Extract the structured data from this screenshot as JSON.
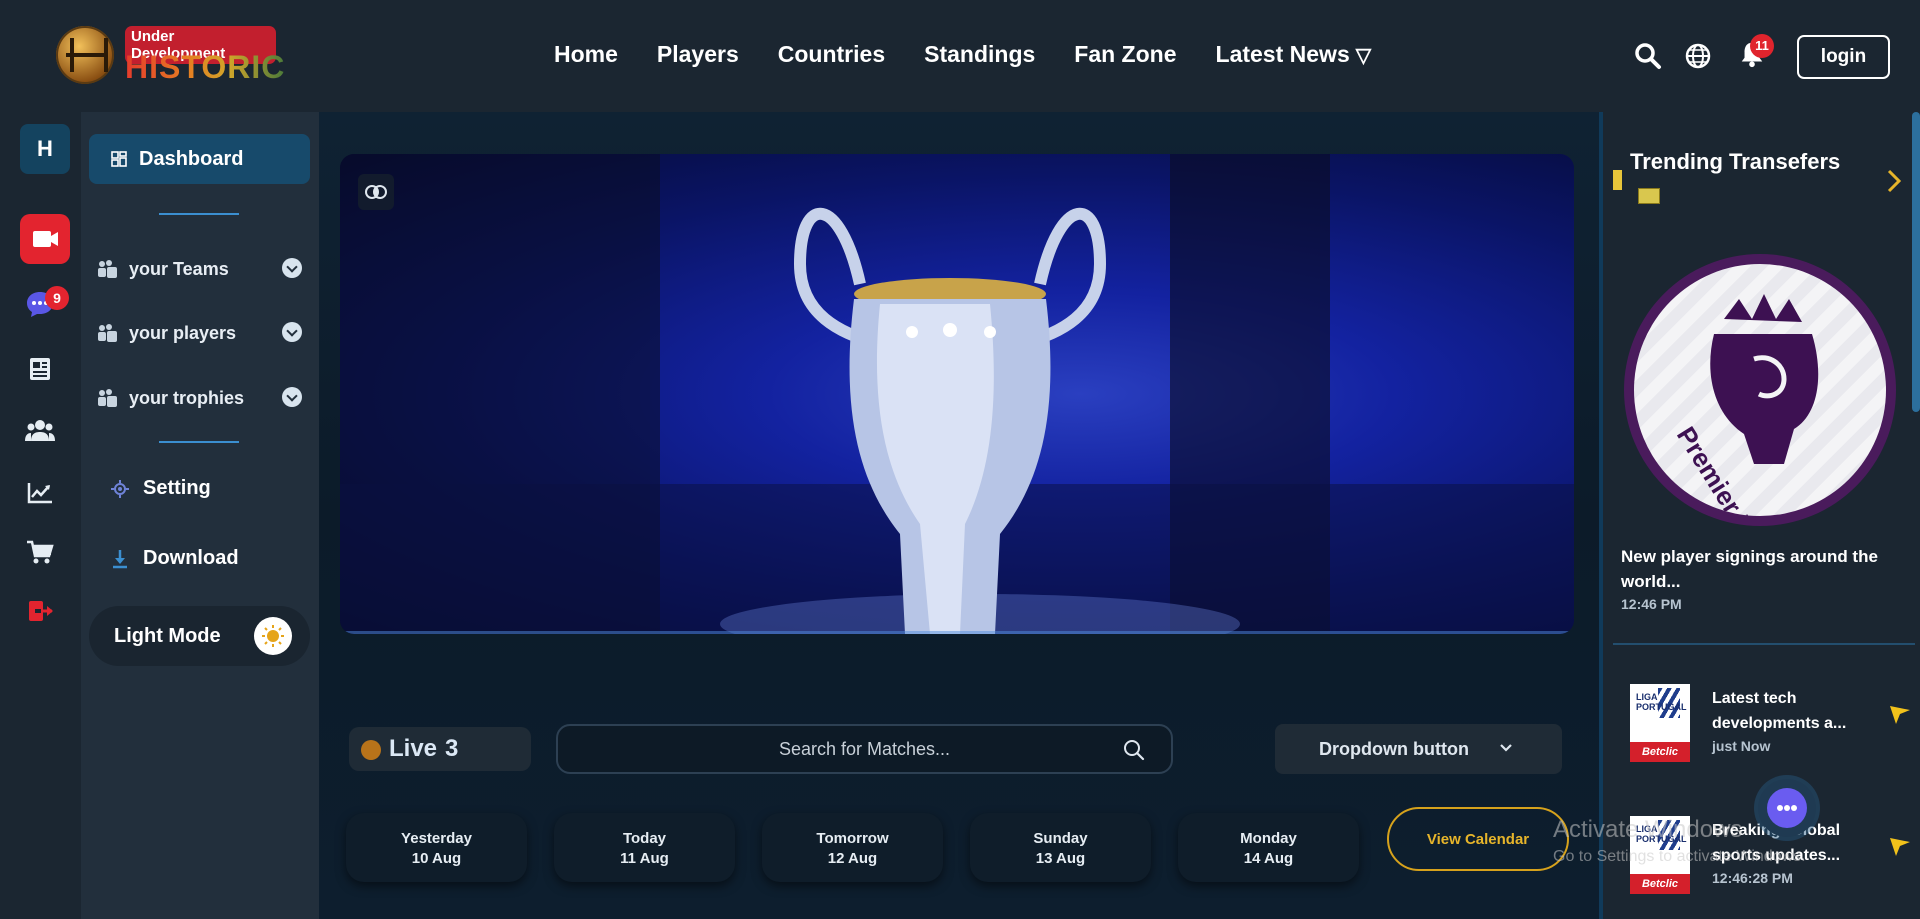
{
  "brand": {
    "badge": "Under Development",
    "name": "HISTORIC"
  },
  "nav": {
    "items": [
      "Home",
      "Players",
      "Countries",
      "Standings",
      "Fan Zone"
    ],
    "latest_news": "Latest News",
    "notifications_count": "11",
    "login_label": "login"
  },
  "rail": {
    "avatar_letter": "H",
    "chat_count": "9"
  },
  "sidebar": {
    "dashboard": "Dashboard",
    "groups": [
      "your Teams",
      "your players",
      "your trophies"
    ],
    "setting": "Setting",
    "download": "Download",
    "mode": "Light Mode"
  },
  "matches": {
    "live_label": "Live",
    "live_count": "3",
    "search_placeholder": "Search for Matches...",
    "dropdown_label": "Dropdown button",
    "days": [
      {
        "name": "Yesterday",
        "date": "10 Aug"
      },
      {
        "name": "Today",
        "date": "11 Aug"
      },
      {
        "name": "Tomorrow",
        "date": "12 Aug"
      },
      {
        "name": "Sunday",
        "date": "13 Aug"
      },
      {
        "name": "Monday",
        "date": "14 Aug"
      }
    ],
    "view_calendar": "View Calendar"
  },
  "trending": {
    "title": "Trending Transefers",
    "feature": {
      "logo_text": "Premier League",
      "headline": "New player signings around the world...",
      "time": "12:46 PM"
    },
    "news": [
      {
        "title": "Latest tech developments a...",
        "time": "just Now",
        "thumb_top": "LIGA PORTUGAL",
        "thumb_brand": "Betclic"
      },
      {
        "title": "Breaking: Global sports updates...",
        "time": "12:46:28 PM",
        "thumb_top": "LIGA PORTUGAL",
        "thumb_brand": "Betclic"
      }
    ]
  },
  "overlay": {
    "activate_line1": "Activate Windows",
    "activate_line2": "Go to Settings to activate Windows."
  },
  "colors": {
    "accent_blue": "#174a6b",
    "alert_red": "#e3242f",
    "gold": "#d6a21c",
    "live_dot": "#b8731a"
  }
}
